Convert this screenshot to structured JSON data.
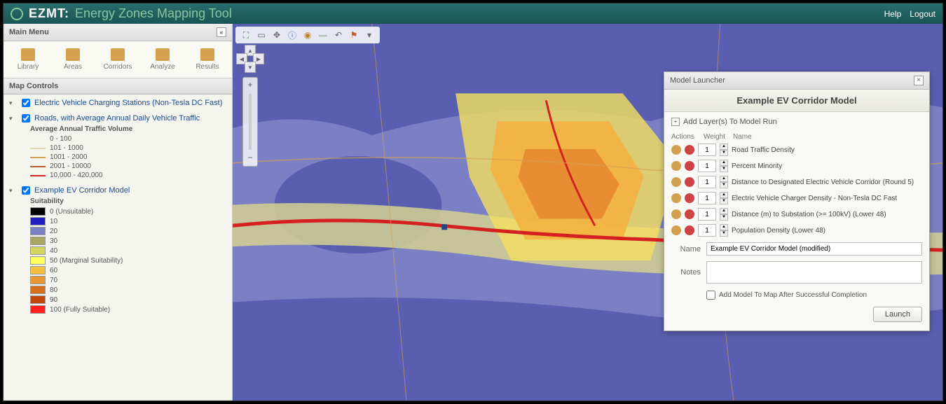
{
  "header": {
    "brand": "EZMT:",
    "subtitle": "Energy Zones Mapping Tool",
    "help": "Help",
    "logout": "Logout"
  },
  "sidebar": {
    "main_menu": "Main Menu",
    "tools": [
      {
        "label": "Library"
      },
      {
        "label": "Areas"
      },
      {
        "label": "Corridors"
      },
      {
        "label": "Analyze"
      },
      {
        "label": "Results"
      }
    ],
    "map_controls": "Map Controls",
    "layers": [
      {
        "title": "Electric Vehicle Charging Stations (Non-Tesla DC Fast)",
        "checked": true
      },
      {
        "title": "Roads, with Average Annual Daily Vehicle Traffic",
        "checked": true,
        "legend_title": "Average Annual Traffic Volume",
        "legend": [
          {
            "color": "#f5f5f0",
            "label": "0 - 100",
            "kind": "line"
          },
          {
            "color": "#e8d8b0",
            "label": "101 - 1000",
            "kind": "line"
          },
          {
            "color": "#d4a050",
            "label": "1001 - 2000",
            "kind": "line"
          },
          {
            "color": "#b86030",
            "label": "2001 - 10000",
            "kind": "line"
          },
          {
            "color": "#d42020",
            "label": "10,000 - 420,000",
            "kind": "line"
          }
        ]
      },
      {
        "title": "Example EV Corridor Model",
        "checked": true,
        "legend_title": "Suitability",
        "legend": [
          {
            "color": "#000000",
            "label": "0 (Unsuitable)"
          },
          {
            "color": "#2020c0",
            "label": "10"
          },
          {
            "color": "#7b7fc4",
            "label": "20"
          },
          {
            "color": "#a8a860",
            "label": "30"
          },
          {
            "color": "#d4d460",
            "label": "40"
          },
          {
            "color": "#ffff60",
            "label": "50 (Marginal Suitability)"
          },
          {
            "color": "#f4c040",
            "label": "60"
          },
          {
            "color": "#e89830",
            "label": "70"
          },
          {
            "color": "#d47020",
            "label": "80"
          },
          {
            "color": "#c04810",
            "label": "90"
          },
          {
            "color": "#ff2020",
            "label": "100 (Fully Suitable)"
          }
        ]
      }
    ]
  },
  "modal": {
    "head": "Model Launcher",
    "title": "Example EV Corridor Model",
    "add_layers": "Add Layer(s) To Model Run",
    "cols": {
      "actions": "Actions",
      "weight": "Weight",
      "name": "Name"
    },
    "params": [
      {
        "w": "1",
        "name": "Road Traffic Density"
      },
      {
        "w": "1",
        "name": "Percent Minority"
      },
      {
        "w": "1",
        "name": "Distance to Designated Electric Vehicle Corridor (Round 5)"
      },
      {
        "w": "1",
        "name": "Electric Vehicle Charger Density - Non-Tesla DC Fast"
      },
      {
        "w": "1",
        "name": "Distance (m) to Substation (>= 100kV) (Lower 48)"
      },
      {
        "w": "1",
        "name": "Population Density (Lower 48)"
      }
    ],
    "name_label": "Name",
    "name_value": "Example EV Corridor Model (modified)",
    "notes_label": "Notes",
    "notes_value": "",
    "add_to_map": "Add Model To Map After Successful Completion",
    "launch": "Launch"
  }
}
